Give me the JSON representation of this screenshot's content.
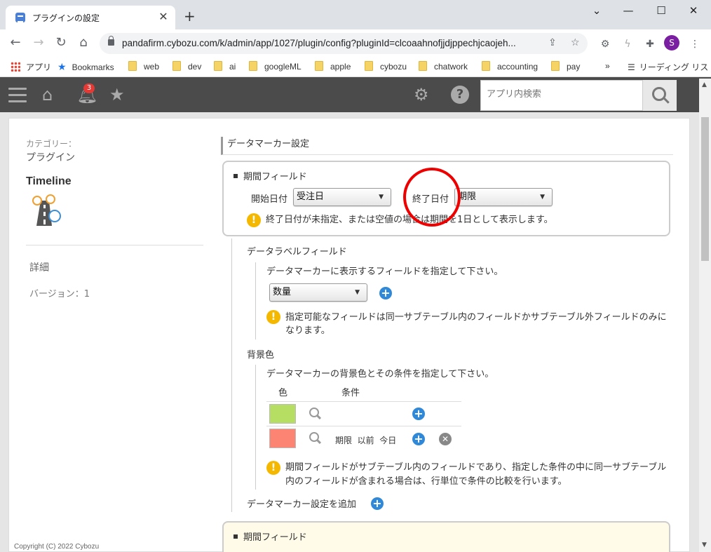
{
  "browser": {
    "tab_title": "プラグインの設定",
    "url": "pandafirm.cybozu.com/k/admin/app/1027/plugin/config?pluginId=clcoaahnofjjdjppechjcaojeh...",
    "profile_initial": "S",
    "bookmarks": [
      {
        "label": "アプリ",
        "icon": "apps-icon"
      },
      {
        "label": "Bookmarks",
        "icon": "star-icon"
      },
      {
        "label": "web",
        "icon": "folder-icon"
      },
      {
        "label": "dev",
        "icon": "folder-icon"
      },
      {
        "label": "ai",
        "icon": "folder-icon"
      },
      {
        "label": "googleML",
        "icon": "folder-icon"
      },
      {
        "label": "apple",
        "icon": "folder-icon"
      },
      {
        "label": "cybozu",
        "icon": "folder-icon"
      },
      {
        "label": "chatwork",
        "icon": "folder-icon"
      },
      {
        "label": "accounting",
        "icon": "folder-icon"
      },
      {
        "label": "pay",
        "icon": "folder-icon"
      }
    ],
    "bookmarks_more": "»",
    "reading_list": "リーディング リスト"
  },
  "header": {
    "notification_count": "3",
    "search_placeholder": "アプリ内検索"
  },
  "sidebar": {
    "category_label": "カテゴリー：",
    "category_value": "プラグイン",
    "app_name": "Timeline",
    "detail_link": "詳細",
    "version": "バージョン：1"
  },
  "main": {
    "section_title": "データマーカー設定",
    "period_field_title": "期間フィールド",
    "start_date_label": "開始日付",
    "start_date_value": "受注日",
    "end_date_label": "終了日付",
    "end_date_value": "期限",
    "end_date_warning": "終了日付が未指定、または空値の場合は期間を1日として表示します。",
    "label_field_heading": "データラベルフィールド",
    "label_field_desc": "データマーカーに表示するフィールドを指定して下さい。",
    "label_field_value": "数量",
    "label_field_warning_1": "指定可能なフィールドは同一サブテーブル内のフィールドかサブテーブル外フィールドのみに",
    "label_field_warning_2": "なります。",
    "bg_color_heading": "背景色",
    "bg_color_desc": "データマーカーの背景色とその条件を指定して下さい。",
    "col_color": "色",
    "col_condition": "条件",
    "color_rows": [
      {
        "color": "#b5de62",
        "condition": ""
      },
      {
        "color": "#fc8472",
        "condition": "期限  以前  今日"
      }
    ],
    "bg_warning_1": "期間フィールドがサブテーブル内のフィールドであり、指定した条件の中に同一サブテーブル",
    "bg_warning_2": "内のフィールドが含まれる場合は、行単位で条件の比較を行います。",
    "add_marker": "データマーカー設定を追加",
    "period_field_title_2": "期間フィールド"
  },
  "footer": {
    "copyright": "Copyright (C) 2022 Cybozu"
  }
}
